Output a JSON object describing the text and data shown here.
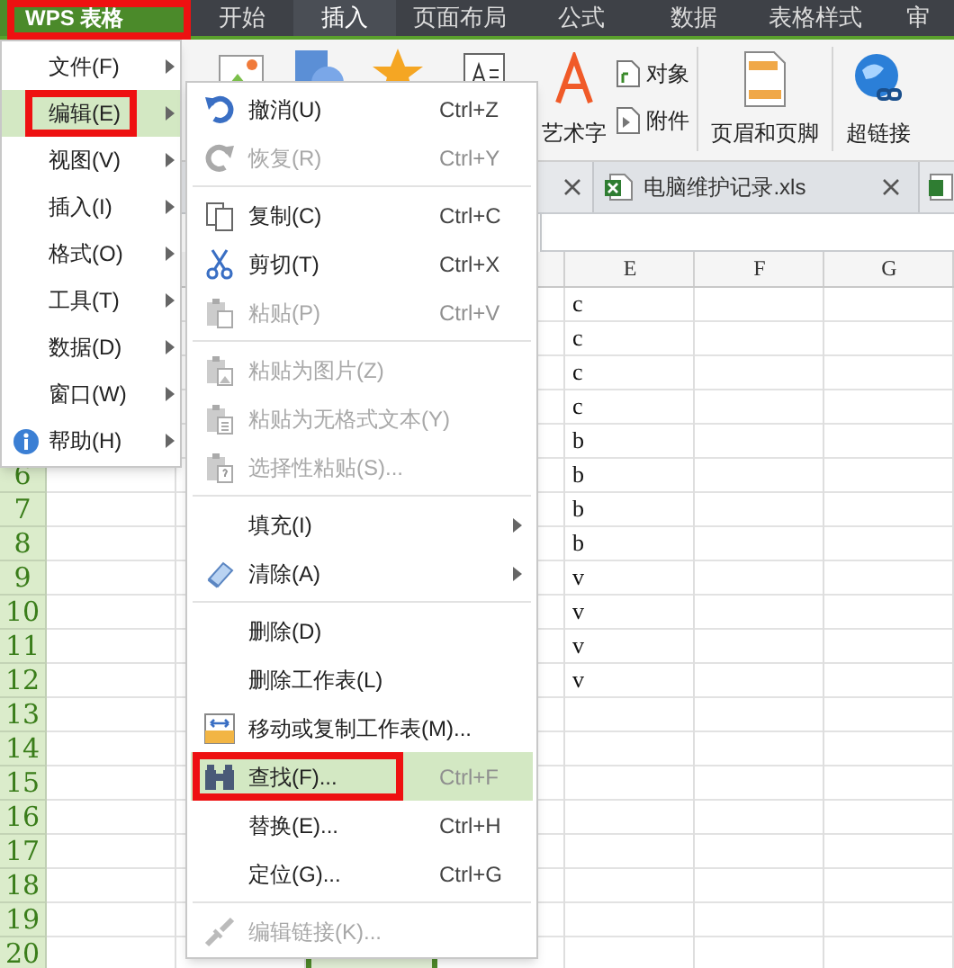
{
  "app_button": {
    "label": "WPS 表格",
    "highlighted": true
  },
  "ribbon_tabs": [
    {
      "label": "开始",
      "selected": false
    },
    {
      "label": "插入",
      "selected": true
    },
    {
      "label": "页面布局",
      "selected": false
    },
    {
      "label": "公式",
      "selected": false
    },
    {
      "label": "数据",
      "selected": false
    },
    {
      "label": "表格样式",
      "selected": false
    },
    {
      "label": "审",
      "selected": false
    }
  ],
  "ribbon_items": [
    {
      "label": "艺术字",
      "kind": "large"
    },
    {
      "label": "对象",
      "kind": "small"
    },
    {
      "label": "附件",
      "kind": "small"
    },
    {
      "label": "页眉和页脚",
      "kind": "large"
    },
    {
      "label": "超链接",
      "kind": "large"
    }
  ],
  "document_tabs": [
    {
      "label": "电脑维护记录.xls"
    }
  ],
  "sheet": {
    "columns": [
      {
        "label": "E"
      },
      {
        "label": "F"
      },
      {
        "label": "G"
      }
    ],
    "row_numbers": [
      "6",
      "7",
      "8",
      "9",
      "10",
      "11",
      "12",
      "13",
      "14",
      "15",
      "16",
      "17",
      "18",
      "19",
      "20"
    ],
    "column_e": [
      "c",
      "c",
      "c",
      "c",
      "b",
      "b",
      "b",
      "b",
      "v",
      "v",
      "v",
      "v"
    ]
  },
  "main_menu": [
    {
      "label": "文件(F)",
      "selected": false,
      "highlighted": false
    },
    {
      "label": "编辑(E)",
      "selected": true,
      "highlighted": true
    },
    {
      "label": "视图(V)",
      "selected": false,
      "highlighted": false
    },
    {
      "label": "插入(I)",
      "selected": false,
      "highlighted": false
    },
    {
      "label": "格式(O)",
      "selected": false,
      "highlighted": false
    },
    {
      "label": "工具(T)",
      "selected": false,
      "highlighted": false
    },
    {
      "label": "数据(D)",
      "selected": false,
      "highlighted": false
    },
    {
      "label": "窗口(W)",
      "selected": false,
      "highlighted": false
    },
    {
      "label": "帮助(H)",
      "selected": false,
      "highlighted": false
    }
  ],
  "edit_menu": [
    {
      "kind": "item",
      "label": "撤消(U)",
      "shortcut": "Ctrl+Z",
      "disabled": false,
      "selected": false,
      "highlighted": false
    },
    {
      "kind": "item",
      "label": "恢复(R)",
      "shortcut": "Ctrl+Y",
      "disabled": true,
      "selected": false,
      "highlighted": false
    },
    {
      "kind": "separator"
    },
    {
      "kind": "item",
      "label": "复制(C)",
      "shortcut": "Ctrl+C",
      "disabled": false,
      "selected": false,
      "highlighted": false
    },
    {
      "kind": "item",
      "label": "剪切(T)",
      "shortcut": "Ctrl+X",
      "disabled": false,
      "selected": false,
      "highlighted": false
    },
    {
      "kind": "item",
      "label": "粘贴(P)",
      "shortcut": "Ctrl+V",
      "disabled": true,
      "selected": false,
      "highlighted": false
    },
    {
      "kind": "separator"
    },
    {
      "kind": "item",
      "label": "粘贴为图片(Z)",
      "disabled": true,
      "selected": false,
      "highlighted": false
    },
    {
      "kind": "item",
      "label": "粘贴为无格式文本(Y)",
      "disabled": true,
      "selected": false,
      "highlighted": false
    },
    {
      "kind": "item",
      "label": "选择性粘贴(S)...",
      "disabled": true,
      "selected": false,
      "highlighted": false
    },
    {
      "kind": "separator"
    },
    {
      "kind": "submenu",
      "label": "填充(I)",
      "disabled": false,
      "selected": false,
      "highlighted": false
    },
    {
      "kind": "submenu",
      "label": "清除(A)",
      "disabled": false,
      "selected": false,
      "highlighted": false
    },
    {
      "kind": "separator"
    },
    {
      "kind": "item",
      "label": "删除(D)",
      "disabled": false,
      "selected": false,
      "highlighted": false
    },
    {
      "kind": "item",
      "label": "删除工作表(L)",
      "disabled": false,
      "selected": false,
      "highlighted": false
    },
    {
      "kind": "item",
      "label": "移动或复制工作表(M)...",
      "disabled": false,
      "selected": false,
      "highlighted": false
    },
    {
      "kind": "item",
      "label": "查找(F)...",
      "shortcut": "Ctrl+F",
      "disabled": false,
      "selected": true,
      "highlighted": true
    },
    {
      "kind": "item",
      "label": "替换(E)...",
      "shortcut": "Ctrl+H",
      "disabled": false,
      "selected": false,
      "highlighted": false
    },
    {
      "kind": "item",
      "label": "定位(G)...",
      "shortcut": "Ctrl+G",
      "disabled": false,
      "selected": false,
      "highlighted": false
    },
    {
      "kind": "separator"
    },
    {
      "kind": "item",
      "label": "编辑链接(K)...",
      "disabled": true,
      "selected": false,
      "highlighted": false
    }
  ]
}
